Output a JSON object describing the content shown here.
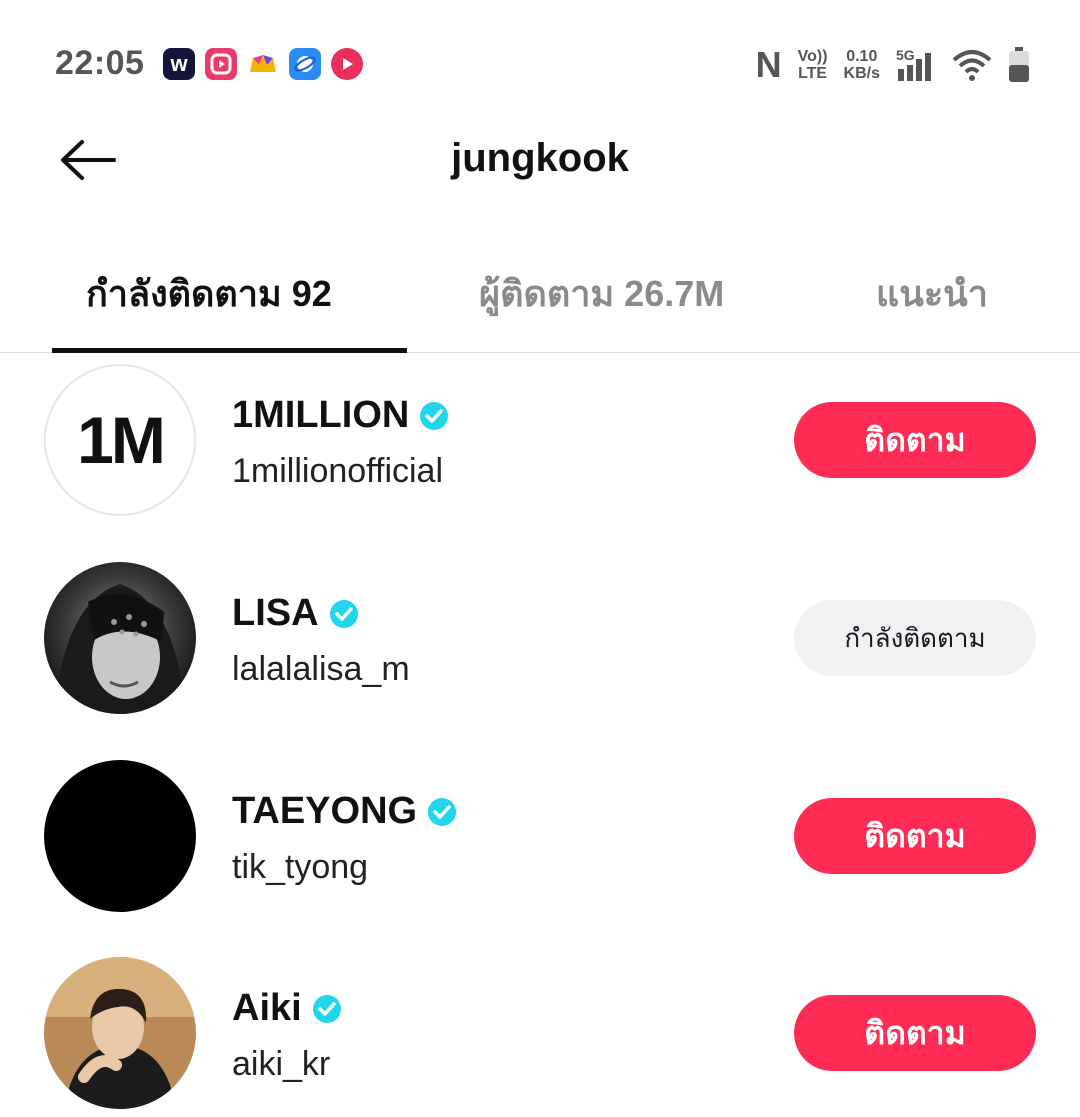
{
  "status_bar": {
    "time": "22:05",
    "app_icons": [
      "w-app-icon",
      "play-app-icon",
      "crown-app-icon",
      "planet-app-icon",
      "music-app-icon"
    ],
    "network": {
      "volte": "Vo))",
      "lte": "LTE",
      "speed_value": "0.10",
      "speed_unit": "KB/s",
      "gen": "5G"
    }
  },
  "header": {
    "title": "jungkook"
  },
  "tabs": [
    {
      "label": "กำลังติดตาม 92",
      "active": true
    },
    {
      "label": "ผู้ติดตาม 26.7M",
      "active": false
    },
    {
      "label": "แนะนำ",
      "active": false
    }
  ],
  "users": [
    {
      "name": "1MILLION",
      "handle": "1millionofficial",
      "avatar_text": "1M",
      "button": "ติดตาม",
      "state": "follow"
    },
    {
      "name": "LISA",
      "handle": "lalalalisa_m",
      "button": "กำลังติดตาม",
      "state": "following"
    },
    {
      "name": "TAEYONG",
      "handle": "tik_tyong",
      "button": "ติดตาม",
      "state": "follow"
    },
    {
      "name": "Aiki",
      "handle": "aiki_kr",
      "button": "ติดตาม",
      "state": "follow"
    }
  ],
  "colors": {
    "follow_button": "#fe2c55",
    "following_button": "#f1f1f2",
    "verified_badge": "#20d5ec"
  }
}
